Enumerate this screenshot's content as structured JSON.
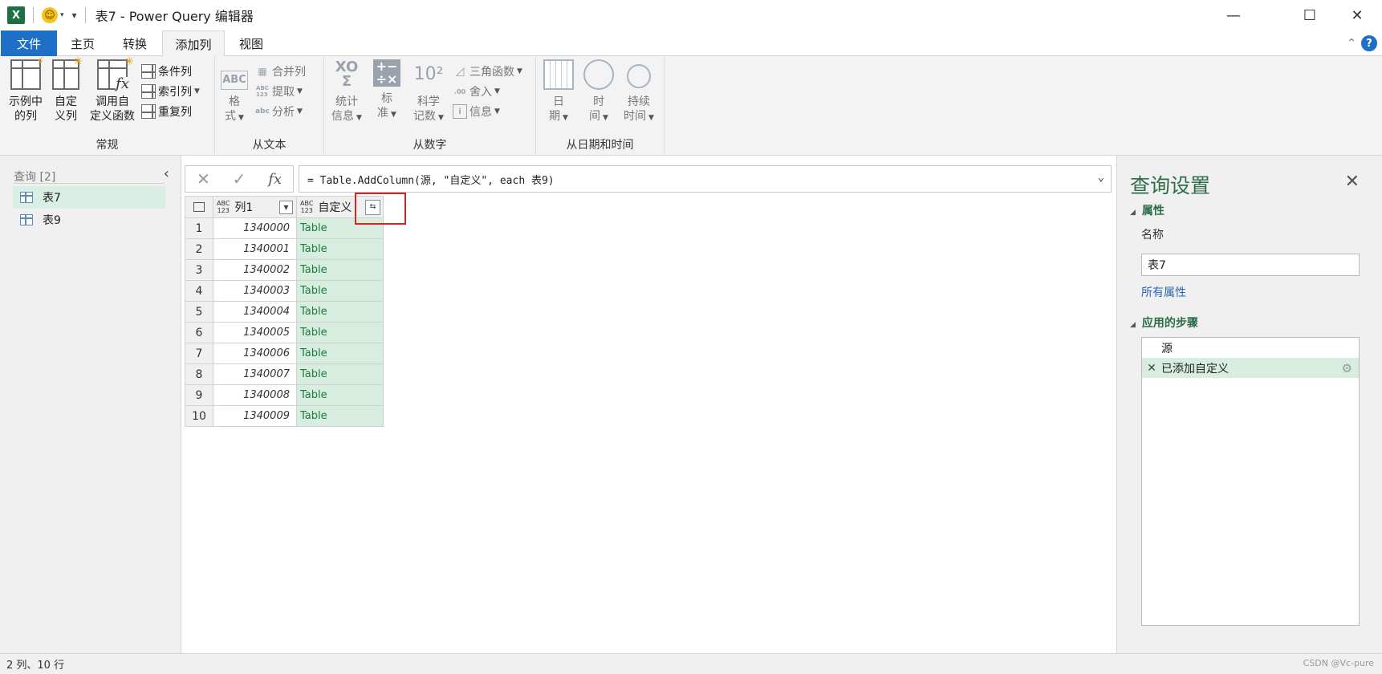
{
  "titlebar": {
    "app_icon": "X",
    "smiley": "☺",
    "title": "表7 - Power Query 编辑器"
  },
  "tabs": [
    {
      "label": "文件"
    },
    {
      "label": "主页"
    },
    {
      "label": "转换"
    },
    {
      "label": "添加列"
    },
    {
      "label": "视图"
    }
  ],
  "ribbon": {
    "general": {
      "label": "常规",
      "example_col": "示例中\n的列",
      "custom_col": "自定\n义列",
      "invoke_fn": "调用自\n定义函数",
      "conditional_col": "条件列",
      "index_col": "索引列",
      "duplicate_col": "重复列"
    },
    "from_text": {
      "label": "从文本",
      "format": "格\n式",
      "merge_cols": "合并列",
      "extract": "提取",
      "parse": "分析"
    },
    "from_number": {
      "label": "从数字",
      "stats": "统计\n信息",
      "standard": "标\n准",
      "scientific": "科学\n记数",
      "trig": "三角函数",
      "rounding": "舍入",
      "info": "信息"
    },
    "from_datetime": {
      "label": "从日期和时间",
      "date": "日\n期",
      "time": "时\n间",
      "duration": "持续\n时间"
    }
  },
  "queries_pane": {
    "header": "查询 [2]",
    "items": [
      {
        "label": "表7",
        "selected": true
      },
      {
        "label": "表9",
        "selected": false
      }
    ]
  },
  "formula_bar": {
    "fx": "fx",
    "formula": "= Table.AddColumn(源, \"自定义\", each 表9)"
  },
  "grid": {
    "columns": [
      {
        "type_badge_top": "ABC",
        "type_badge_bottom": "123",
        "name": "列1"
      },
      {
        "type_badge_top": "ABC",
        "type_badge_bottom": "123",
        "name": "自定义"
      }
    ],
    "rows": [
      {
        "n": "1",
        "c1": "1340000",
        "c2": "Table"
      },
      {
        "n": "2",
        "c1": "1340001",
        "c2": "Table"
      },
      {
        "n": "3",
        "c1": "1340002",
        "c2": "Table"
      },
      {
        "n": "4",
        "c1": "1340003",
        "c2": "Table"
      },
      {
        "n": "5",
        "c1": "1340004",
        "c2": "Table"
      },
      {
        "n": "6",
        "c1": "1340005",
        "c2": "Table"
      },
      {
        "n": "7",
        "c1": "1340006",
        "c2": "Table"
      },
      {
        "n": "8",
        "c1": "1340007",
        "c2": "Table"
      },
      {
        "n": "9",
        "c1": "1340008",
        "c2": "Table"
      },
      {
        "n": "10",
        "c1": "1340009",
        "c2": "Table"
      }
    ]
  },
  "query_settings": {
    "title": "查询设置",
    "properties_title": "属性",
    "name_label": "名称",
    "name_value": "表7",
    "all_properties": "所有属性",
    "steps_title": "应用的步骤",
    "steps": [
      {
        "label": "源",
        "selected": false
      },
      {
        "label": "已添加自定义",
        "selected": true
      }
    ]
  },
  "statusbar": {
    "text": "2 列、10 行",
    "watermark": "CSDN @Vc-pure"
  },
  "colors": {
    "file_tab": "#1e6fc8",
    "accent_green": "#2b6d47",
    "selection_green": "#d6ede0",
    "highlight_box": "#e02020"
  }
}
